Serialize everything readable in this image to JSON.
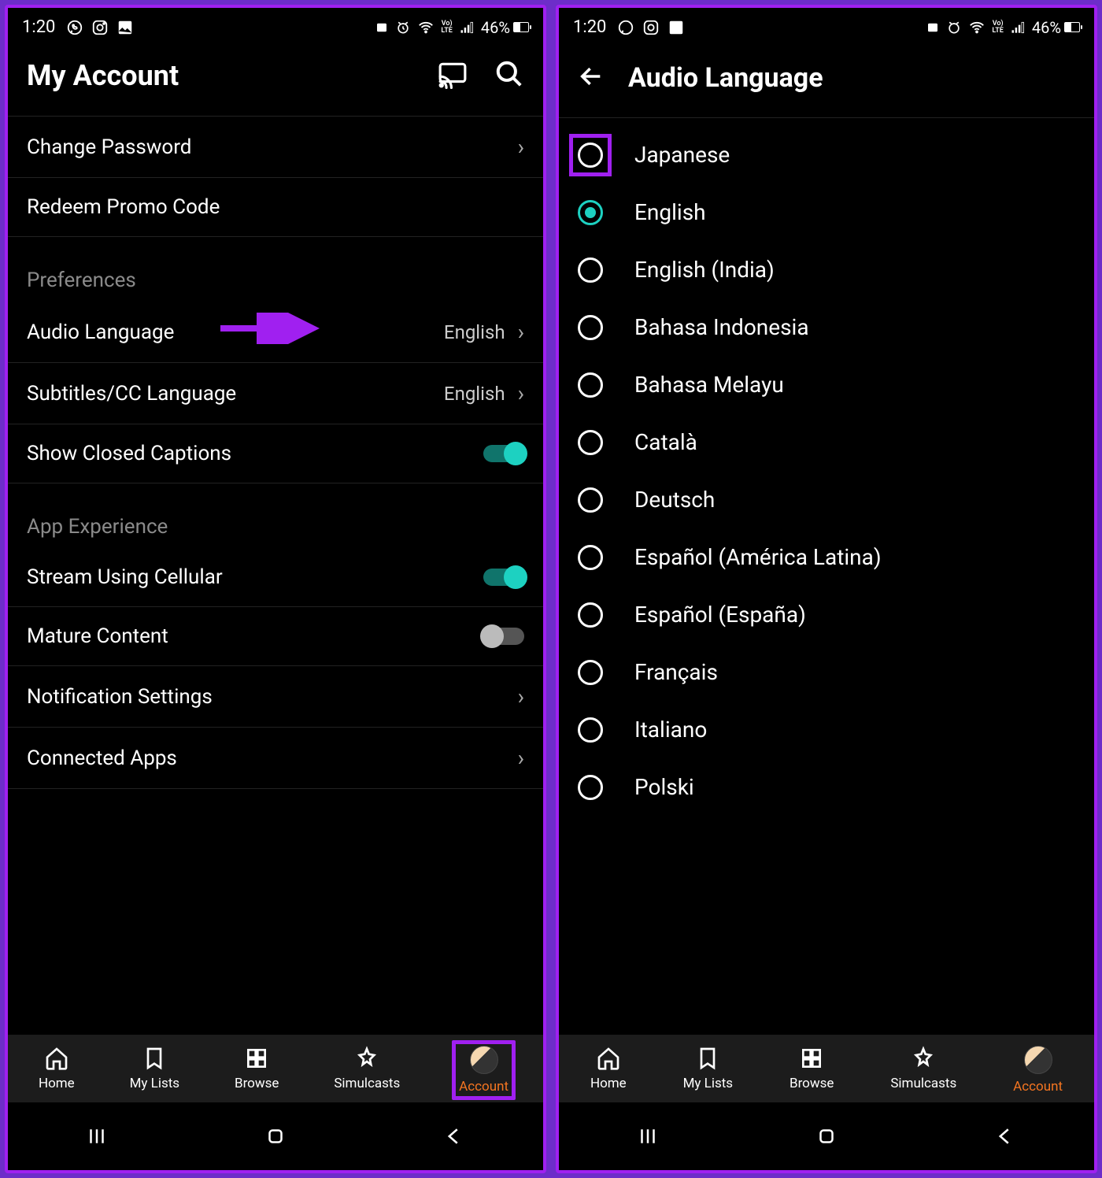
{
  "status": {
    "time": "1:20",
    "battery_percent": "46%",
    "battery_fill": 46
  },
  "left": {
    "header_title": "My Account",
    "rows": {
      "change_password": "Change Password",
      "redeem_promo": "Redeem Promo Code",
      "preferences_header": "Preferences",
      "audio_language": "Audio Language",
      "audio_language_value": "English",
      "subtitles": "Subtitles/CC Language",
      "subtitles_value": "English",
      "closed_captions": "Show Closed Captions",
      "app_experience_header": "App Experience",
      "stream_cellular": "Stream Using Cellular",
      "mature_content": "Mature Content",
      "notification_settings": "Notification Settings",
      "connected_apps": "Connected Apps"
    }
  },
  "right": {
    "header_title": "Audio Language",
    "options": [
      {
        "label": "Japanese",
        "selected": false,
        "highlight": true
      },
      {
        "label": "English",
        "selected": true,
        "highlight": false
      },
      {
        "label": "English (India)",
        "selected": false,
        "highlight": false
      },
      {
        "label": "Bahasa Indonesia",
        "selected": false,
        "highlight": false
      },
      {
        "label": "Bahasa Melayu",
        "selected": false,
        "highlight": false
      },
      {
        "label": "Català",
        "selected": false,
        "highlight": false
      },
      {
        "label": "Deutsch",
        "selected": false,
        "highlight": false
      },
      {
        "label": "Español (América Latina)",
        "selected": false,
        "highlight": false
      },
      {
        "label": "Español (España)",
        "selected": false,
        "highlight": false
      },
      {
        "label": "Français",
        "selected": false,
        "highlight": false
      },
      {
        "label": "Italiano",
        "selected": false,
        "highlight": false
      },
      {
        "label": "Polski",
        "selected": false,
        "highlight": false
      }
    ]
  },
  "tabs": [
    {
      "id": "home",
      "label": "Home"
    },
    {
      "id": "my-lists",
      "label": "My Lists"
    },
    {
      "id": "browse",
      "label": "Browse"
    },
    {
      "id": "simulcasts",
      "label": "Simulcasts"
    },
    {
      "id": "account",
      "label": "Account"
    }
  ]
}
